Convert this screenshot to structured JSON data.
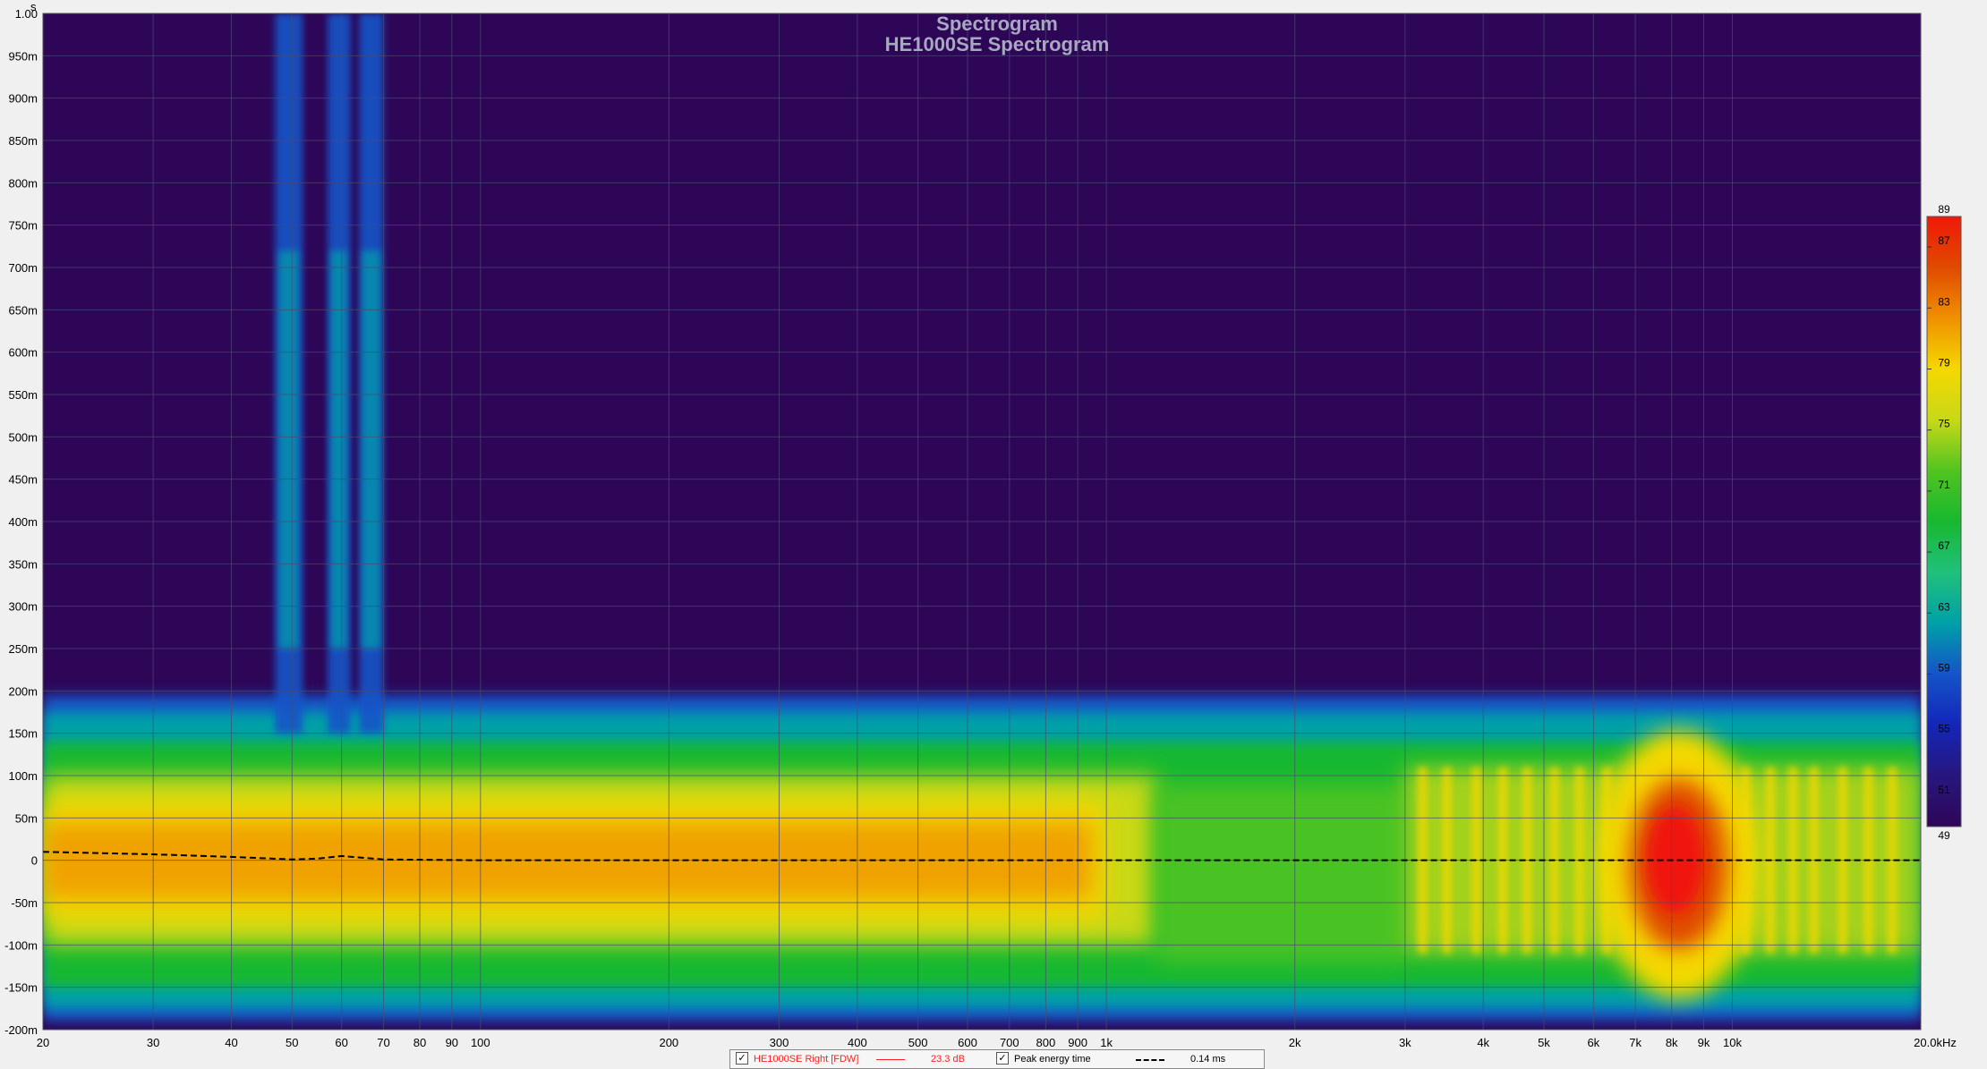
{
  "chart_data": {
    "type": "heatmap",
    "title": "Spectrogram",
    "subtitle": "HE1000SE Spectrogram",
    "x_scale": "log",
    "xlim": [
      20,
      20000
    ],
    "ylim": [
      -200,
      1000
    ],
    "x_ticks": [
      {
        "value": 20,
        "label": "20"
      },
      {
        "value": 30,
        "label": "30"
      },
      {
        "value": 40,
        "label": "40"
      },
      {
        "value": 50,
        "label": "50"
      },
      {
        "value": 60,
        "label": "60"
      },
      {
        "value": 70,
        "label": "70"
      },
      {
        "value": 80,
        "label": "80"
      },
      {
        "value": 90,
        "label": "90"
      },
      {
        "value": 100,
        "label": "100"
      },
      {
        "value": 200,
        "label": "200"
      },
      {
        "value": 300,
        "label": "300"
      },
      {
        "value": 400,
        "label": "400"
      },
      {
        "value": 500,
        "label": "500"
      },
      {
        "value": 600,
        "label": "600"
      },
      {
        "value": 700,
        "label": "700"
      },
      {
        "value": 800,
        "label": "800"
      },
      {
        "value": 900,
        "label": "900"
      },
      {
        "value": 1000,
        "label": "1k"
      },
      {
        "value": 2000,
        "label": "2k"
      },
      {
        "value": 3000,
        "label": "3k"
      },
      {
        "value": 4000,
        "label": "4k"
      },
      {
        "value": 5000,
        "label": "5k"
      },
      {
        "value": 6000,
        "label": "6k"
      },
      {
        "value": 7000,
        "label": "7k"
      },
      {
        "value": 8000,
        "label": "8k"
      },
      {
        "value": 9000,
        "label": "9k"
      },
      {
        "value": 10000,
        "label": "10k"
      },
      {
        "value": 20000,
        "label": "20.0kHz"
      }
    ],
    "y_ticks": [
      {
        "value": 1000,
        "label": "1.00"
      },
      {
        "value": 950,
        "label": "950m"
      },
      {
        "value": 900,
        "label": "900m"
      },
      {
        "value": 850,
        "label": "850m"
      },
      {
        "value": 800,
        "label": "800m"
      },
      {
        "value": 750,
        "label": "750m"
      },
      {
        "value": 700,
        "label": "700m"
      },
      {
        "value": 650,
        "label": "650m"
      },
      {
        "value": 600,
        "label": "600m"
      },
      {
        "value": 550,
        "label": "550m"
      },
      {
        "value": 500,
        "label": "500m"
      },
      {
        "value": 450,
        "label": "450m"
      },
      {
        "value": 400,
        "label": "400m"
      },
      {
        "value": 350,
        "label": "350m"
      },
      {
        "value": 300,
        "label": "300m"
      },
      {
        "value": 250,
        "label": "250m"
      },
      {
        "value": 200,
        "label": "200m"
      },
      {
        "value": 150,
        "label": "150m"
      },
      {
        "value": 100,
        "label": "100m"
      },
      {
        "value": 50,
        "label": "50m"
      },
      {
        "value": 0,
        "label": "0"
      },
      {
        "value": -50,
        "label": "-50m"
      },
      {
        "value": -100,
        "label": "-100m"
      },
      {
        "value": -150,
        "label": "-150m"
      },
      {
        "value": -200,
        "label": "-200m"
      }
    ],
    "y_axis_unit": "s",
    "colorbar": {
      "min": 49,
      "max": 89,
      "ticks": [
        89,
        87,
        83,
        79,
        75,
        71,
        67,
        63,
        59,
        55,
        51,
        49
      ],
      "colors": [
        "#2e0658",
        "#28167e",
        "#1326b8",
        "#1454c8",
        "#00a0a8",
        "#20c07c",
        "#18b830",
        "#50c420",
        "#c8d818",
        "#f4d800",
        "#f09000",
        "#e04a00",
        "#f01808"
      ]
    },
    "background_color": "#2e0658",
    "grid": true,
    "peak_energy_time": {
      "x": [
        20,
        30,
        40,
        50,
        55,
        60,
        70,
        100,
        200,
        500,
        1000,
        2000,
        5000,
        10000,
        20000
      ],
      "y": [
        10,
        7,
        4,
        1,
        2,
        5,
        1,
        0,
        0,
        0,
        0,
        0,
        0,
        0,
        0
      ]
    },
    "legend": [
      {
        "label": "HE1000SE Right [FDW]",
        "value": "23.3 dB",
        "color": "#ff2020",
        "line": "solid"
      },
      {
        "label": "Peak energy time",
        "value": "0.14 ms",
        "color": "#000000",
        "line": "dashed"
      }
    ],
    "legend_position": "bottom-center"
  }
}
